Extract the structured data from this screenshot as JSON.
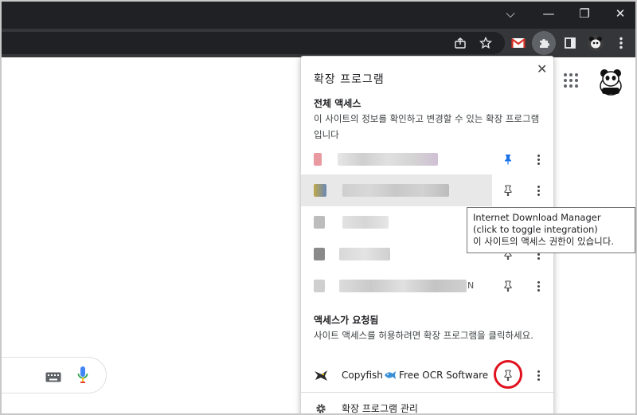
{
  "window": {
    "controls": {
      "dropdown": "⌵",
      "minimize": "—",
      "maximize": "❐",
      "close": "✕"
    }
  },
  "colors": {
    "accent_pin": "#1a73e8",
    "highlight_circle": "#e0101d",
    "chrome_dark": "#202124"
  },
  "popup": {
    "title": "확장 프로그램",
    "close_label": "✕",
    "full_access": {
      "heading": "전체 액세스",
      "description": "이 사이트의 정보를 확인하고 변경할 수 있는 확장 프로그램입니다"
    },
    "rows": [
      {
        "name": "",
        "pinned": true
      },
      {
        "name": "",
        "pinned": false
      },
      {
        "name": "",
        "pinned": false
      },
      {
        "name": "",
        "pinned": false
      },
      {
        "name": "",
        "trailing": "N",
        "pinned": false
      }
    ],
    "requests_access": {
      "heading": "액세스가 요청됨",
      "description": "사이트 액세스를 허용하려면 확장 프로그램을 클릭하세요.",
      "extension_name": "Copyfish",
      "extension_name_2": "Free OCR Software"
    },
    "manage_label": "확장 프로그램 관리"
  },
  "tooltip": {
    "line1": "Internet Download Manager",
    "line2": "(click to toggle integration)",
    "line3": "이 사이트의 액세스 권한이 있습니다."
  }
}
